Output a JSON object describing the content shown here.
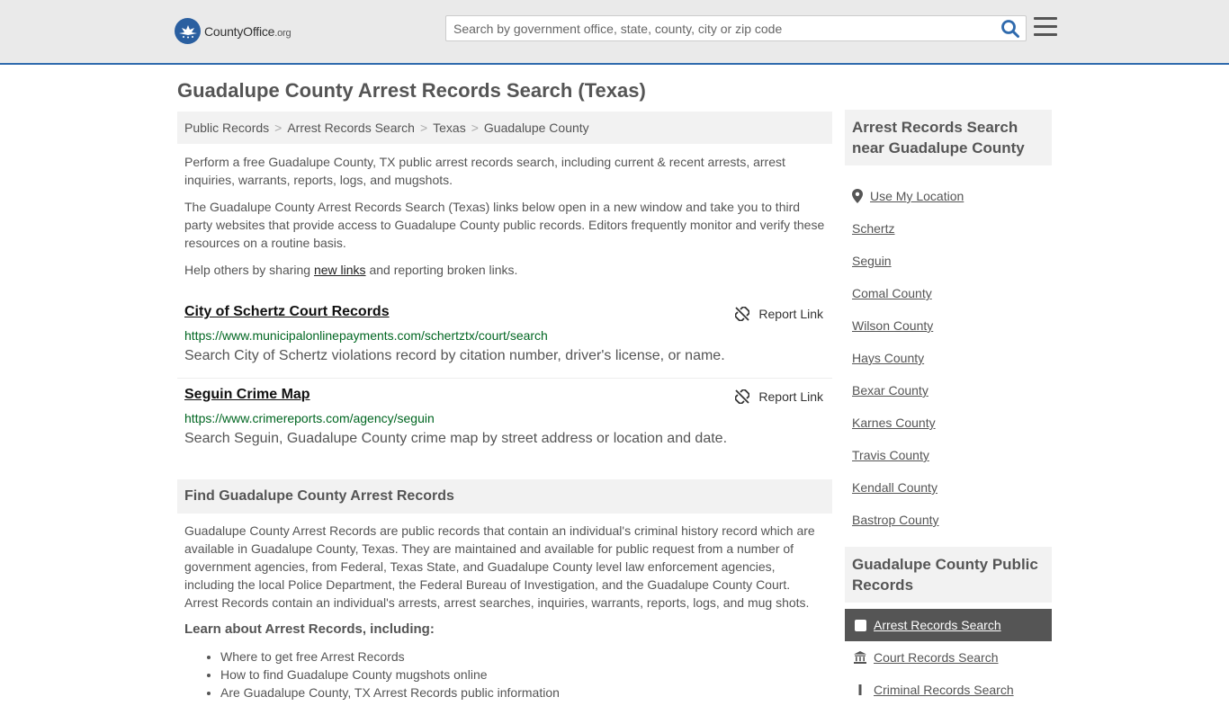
{
  "header": {
    "logo_name": "CountyOffice",
    "logo_domain": ".org",
    "search_placeholder": "Search by government office, state, county, city or zip code"
  },
  "page_title": "Guadalupe County Arrest Records Search (Texas)",
  "breadcrumb": [
    "Public Records",
    "Arrest Records Search",
    "Texas",
    "Guadalupe County"
  ],
  "intro": {
    "p1": "Perform a free Guadalupe County, TX public arrest records search, including current & recent arrests, arrest inquiries, warrants, reports, logs, and mugshots.",
    "p2": "The Guadalupe County Arrest Records Search (Texas) links below open in a new window and take you to third party websites that provide access to Guadalupe County public records. Editors frequently monitor and verify these resources on a routine basis.",
    "p3_before": "Help others by sharing ",
    "p3_link": "new links",
    "p3_after": " and reporting broken links."
  },
  "results": [
    {
      "title": "City of Schertz Court Records",
      "url": "https://www.municipalonlinepayments.com/schertztx/court/search",
      "description": "Search City of Schertz violations record by citation number, driver's license, or name.",
      "report_label": "Report Link"
    },
    {
      "title": "Seguin Crime Map",
      "url": "https://www.crimereports.com/agency/seguin",
      "description": "Search Seguin, Guadalupe County crime map by street address or location and date.",
      "report_label": "Report Link"
    }
  ],
  "find_section": {
    "heading": "Find Guadalupe County Arrest Records",
    "body": "Guadalupe County Arrest Records are public records that contain an individual's criminal history record which are available in Guadalupe County, Texas. They are maintained and available for public request from a number of government agencies, from Federal, Texas State, and Guadalupe County level law enforcement agencies, including the local Police Department, the Federal Bureau of Investigation, and the Guadalupe County Court. Arrest Records contain an individual's arrests, arrest searches, inquiries, warrants, reports, logs, and mug shots.",
    "learn_heading": "Learn about Arrest Records, including:",
    "learn_items": [
      "Where to get free Arrest Records",
      "How to find Guadalupe County mugshots online",
      "Are Guadalupe County, TX Arrest Records public information"
    ]
  },
  "sidebar": {
    "near_heading": "Arrest Records Search near Guadalupe County",
    "use_location": "Use My Location",
    "near_items": [
      "Schertz",
      "Seguin",
      "Comal County",
      "Wilson County",
      "Hays County",
      "Bexar County",
      "Karnes County",
      "Travis County",
      "Kendall County",
      "Bastrop County"
    ],
    "public_heading": "Guadalupe County Public Records",
    "public_items": [
      "Arrest Records Search",
      "Court Records Search",
      "Criminal Records Search"
    ]
  },
  "colors": {
    "accent": "#2f6aad",
    "url_green": "#006621",
    "active_bg": "#555555"
  }
}
